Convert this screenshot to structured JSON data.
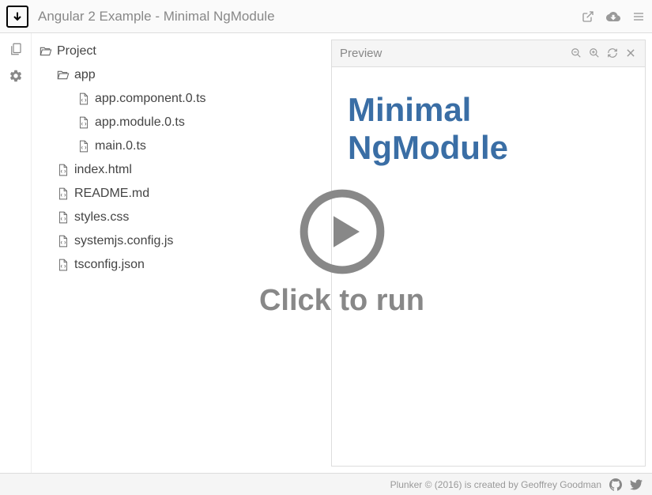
{
  "header": {
    "title": "Angular 2 Example - Minimal NgModule"
  },
  "filetree": {
    "root": "Project",
    "folder": "app",
    "appFiles": [
      "app.component.0.ts",
      "app.module.0.ts",
      "main.0.ts"
    ],
    "rootFiles": [
      "index.html",
      "README.md",
      "styles.css",
      "systemjs.config.js",
      "tsconfig.json"
    ]
  },
  "preview": {
    "label": "Preview",
    "content_line1": "Minimal",
    "content_line2": "NgModule"
  },
  "overlay": {
    "run_text": "Click to run"
  },
  "footer": {
    "text": "Plunker © (2016) is created by Geoffrey Goodman"
  }
}
